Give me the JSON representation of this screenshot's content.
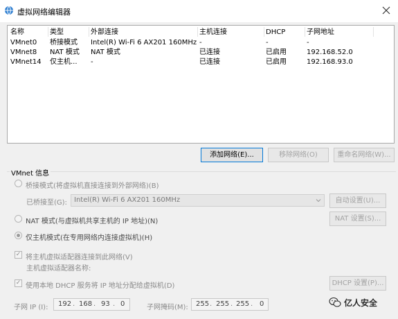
{
  "window": {
    "title": "虚拟网络编辑器"
  },
  "table": {
    "columns": [
      "名称",
      "类型",
      "外部连接",
      "主机连接",
      "DHCP",
      "子网地址"
    ],
    "rows": [
      [
        "VMnet0",
        "桥接模式",
        "Intel(R) Wi-Fi 6 AX201 160MHz",
        "-",
        "-",
        "-"
      ],
      [
        "VMnet8",
        "NAT 模式",
        "NAT 模式",
        "已连接",
        "已启用",
        "192.168.52.0"
      ],
      [
        "VMnet14",
        "仅主机...",
        "-",
        "已连接",
        "已启用",
        "192.168.93.0"
      ]
    ]
  },
  "buttons": {
    "add": "添加网络(E)...",
    "remove": "移除网络(O)",
    "rename": "重命名网络(W)..."
  },
  "vmnet_info": {
    "label": "VMnet 信息",
    "bridge_label": "桥接模式(将虚拟机直接连接到外部网络)(B)",
    "bridged_to_label": "已桥接至(G):",
    "bridged_to_value": "Intel(R) Wi-Fi 6 AX201 160MHz",
    "auto_settings": "自动设置(U)...",
    "nat_label": "NAT 模式(与虚拟机共享主机的 IP 地址)(N)",
    "nat_settings": "NAT 设置(S)...",
    "host_only_label": "仅主机模式(在专用网络内连接虚拟机)(H)",
    "connect_adapter_label": "将主机虚拟适配器连接到此网络(V)",
    "adapter_name_label": "主机虚拟适配器名称:",
    "dhcp_label": "使用本地 DHCP 服务将 IP 地址分配给虚拟机(D)",
    "dhcp_settings": "DHCP 设置(P)...",
    "subnet_ip_label": "子网 IP (I):",
    "subnet_ip": [
      "192",
      "168",
      "93",
      "0"
    ],
    "subnet_mask_label": "子网掩码(M):",
    "subnet_mask": [
      "255",
      "255",
      "255",
      "0"
    ]
  },
  "watermark": {
    "text": "亿人安全"
  },
  "icons": {
    "app": "globe-icon",
    "close": "close-icon",
    "dropdown": "chevron-down-icon",
    "watermark": "wechat-icon"
  }
}
